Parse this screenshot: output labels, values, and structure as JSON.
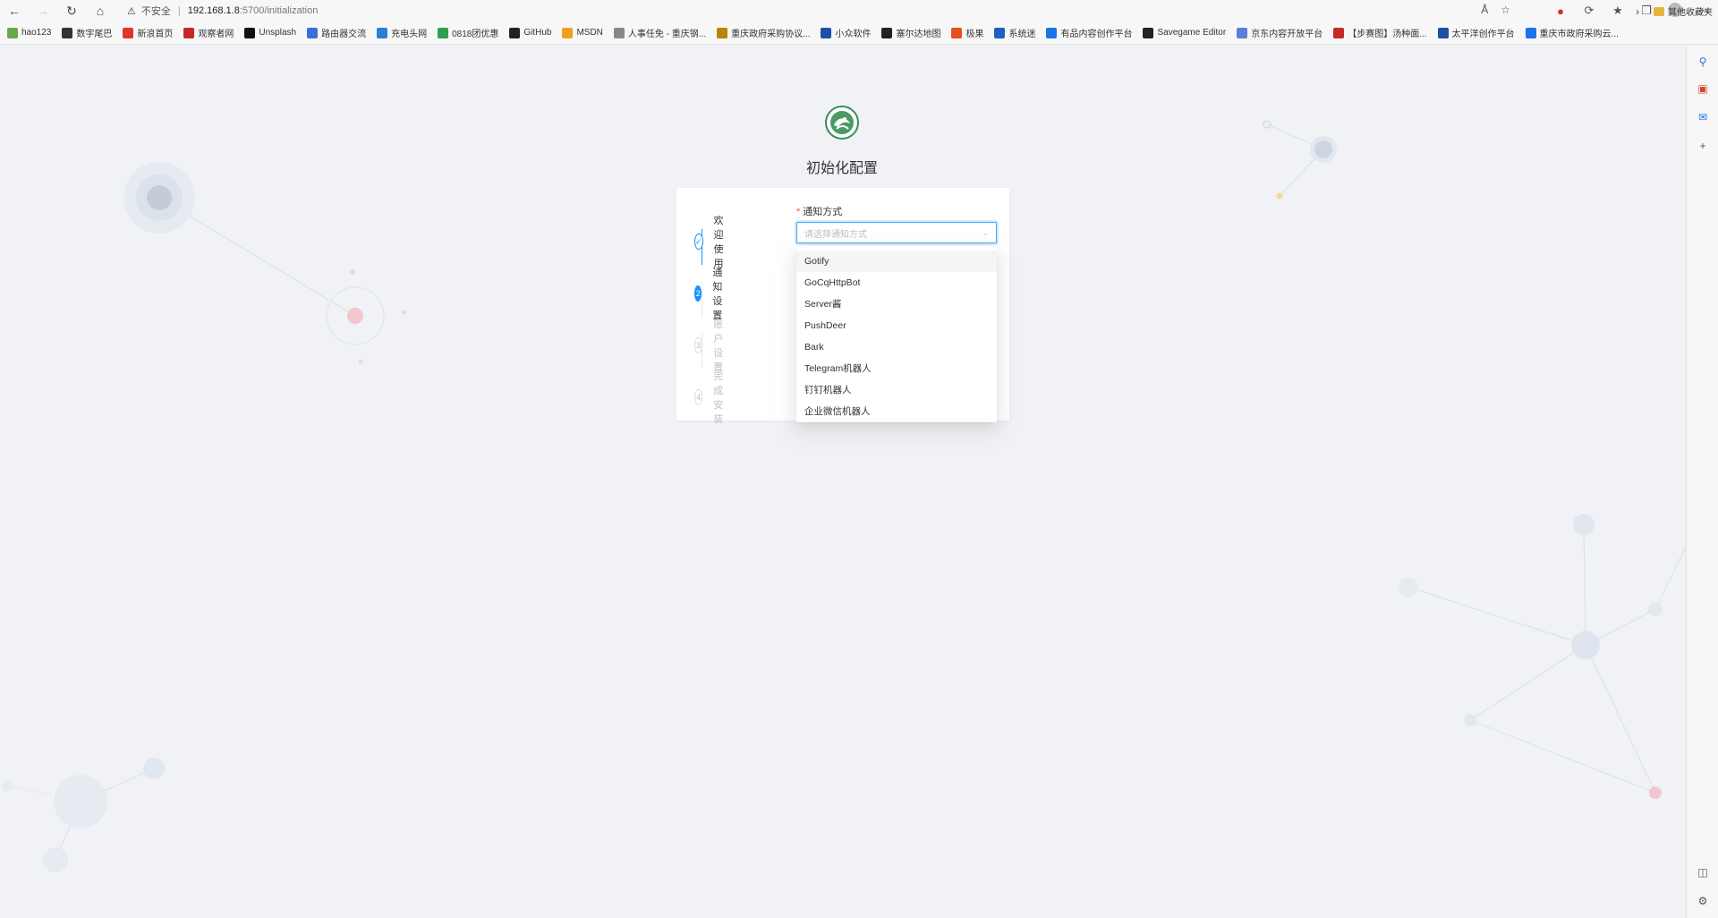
{
  "browser": {
    "insecure_label": "不安全",
    "host": "192.168.1.8",
    "path": ":5700/initialization",
    "bookmarks": [
      {
        "label": "hao123",
        "color": "#6aa84f"
      },
      {
        "label": "数字尾巴",
        "color": "#333333"
      },
      {
        "label": "新浪首页",
        "color": "#e0352b"
      },
      {
        "label": "观察者网",
        "color": "#c62828"
      },
      {
        "label": "Unsplash",
        "color": "#111111"
      },
      {
        "label": "路由器交流",
        "color": "#3b6fd8"
      },
      {
        "label": "充电头网",
        "color": "#2a7fd4"
      },
      {
        "label": "0818团优惠",
        "color": "#2e9e4f"
      },
      {
        "label": "GitHub",
        "color": "#222222"
      },
      {
        "label": "MSDN",
        "color": "#f0a020"
      },
      {
        "label": "人事任免 - 重庆钢...",
        "color": "#888888"
      },
      {
        "label": "重庆政府采购协议...",
        "color": "#b8860b"
      },
      {
        "label": "小众软件",
        "color": "#1e4fa8"
      },
      {
        "label": "塞尔达地图",
        "color": "#222222"
      },
      {
        "label": "极果",
        "color": "#e94e1b"
      },
      {
        "label": "系统迷",
        "color": "#1f5fbf"
      },
      {
        "label": "有品内容创作平台",
        "color": "#1a73e8"
      },
      {
        "label": "Savegame Editor",
        "color": "#222222"
      },
      {
        "label": "京东内容开放平台",
        "color": "#5b7fd6"
      },
      {
        "label": "【步赛图】汤种面...",
        "color": "#c62828"
      },
      {
        "label": "太平洋创作平台",
        "color": "#1e50a2"
      },
      {
        "label": "重庆市政府采购云...",
        "color": "#1a73e8"
      }
    ],
    "other_bookmarks": "其他收藏夹"
  },
  "page": {
    "title": "初始化配置",
    "steps": [
      {
        "number": "✓",
        "label": "欢迎使用",
        "state": "done"
      },
      {
        "number": "2",
        "label": "通知设置",
        "state": "active"
      },
      {
        "number": "3",
        "label": "账户设置",
        "state": "wait"
      },
      {
        "number": "4",
        "label": "完成安装",
        "state": "wait"
      }
    ],
    "form": {
      "required_mark": "*",
      "label": "通知方式",
      "placeholder": "请选择通知方式"
    },
    "dropdown_options": [
      "Gotify",
      "GoCqHttpBot",
      "Server酱",
      "PushDeer",
      "Bark",
      "Telegram机器人",
      "钉钉机器人",
      "企业微信机器人"
    ]
  },
  "colors": {
    "primary": "#1890ff",
    "background": "#f0f2f5"
  }
}
